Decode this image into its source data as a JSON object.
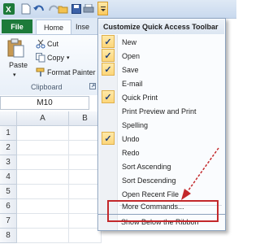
{
  "qat": {
    "icons": [
      "excel-icon",
      "new-document-icon",
      "save-icon",
      "undo-icon",
      "redo-icon",
      "open-icon",
      "save-disk-icon",
      "print-icon",
      "customize-dropdown-icon"
    ]
  },
  "tabs": {
    "file": "File",
    "home": "Home",
    "insert_partial": "Inse"
  },
  "clipboard": {
    "paste": "Paste",
    "cut": "Cut",
    "copy": "Copy",
    "format_painter": "Format Painter",
    "group_label": "Clipboard"
  },
  "name_box": "M10",
  "columns": [
    "A",
    "B"
  ],
  "rows": [
    "1",
    "2",
    "3",
    "4",
    "5",
    "6",
    "7",
    "8"
  ],
  "menu": {
    "title": "Customize Quick Access Toolbar",
    "items": [
      {
        "label": "New",
        "checked": true
      },
      {
        "label": "Open",
        "checked": true
      },
      {
        "label": "Save",
        "checked": true
      },
      {
        "label": "E-mail",
        "checked": false
      },
      {
        "label": "Quick Print",
        "checked": true
      },
      {
        "label": "Print Preview and Print",
        "checked": false
      },
      {
        "label": "Spelling",
        "checked": false
      },
      {
        "label": "Undo",
        "checked": true
      },
      {
        "label": "Redo",
        "checked": false
      },
      {
        "label": "Sort Ascending",
        "checked": false
      },
      {
        "label": "Sort Descending",
        "checked": false
      },
      {
        "label": "Open Recent File",
        "checked": false
      }
    ],
    "more_commands": "More Commands...",
    "show_below": "Show Below the Ribbon"
  },
  "colors": {
    "highlight_box": "#c3282b",
    "file_tab": "#1d7a3a",
    "check_bg": "#fcd67a"
  }
}
